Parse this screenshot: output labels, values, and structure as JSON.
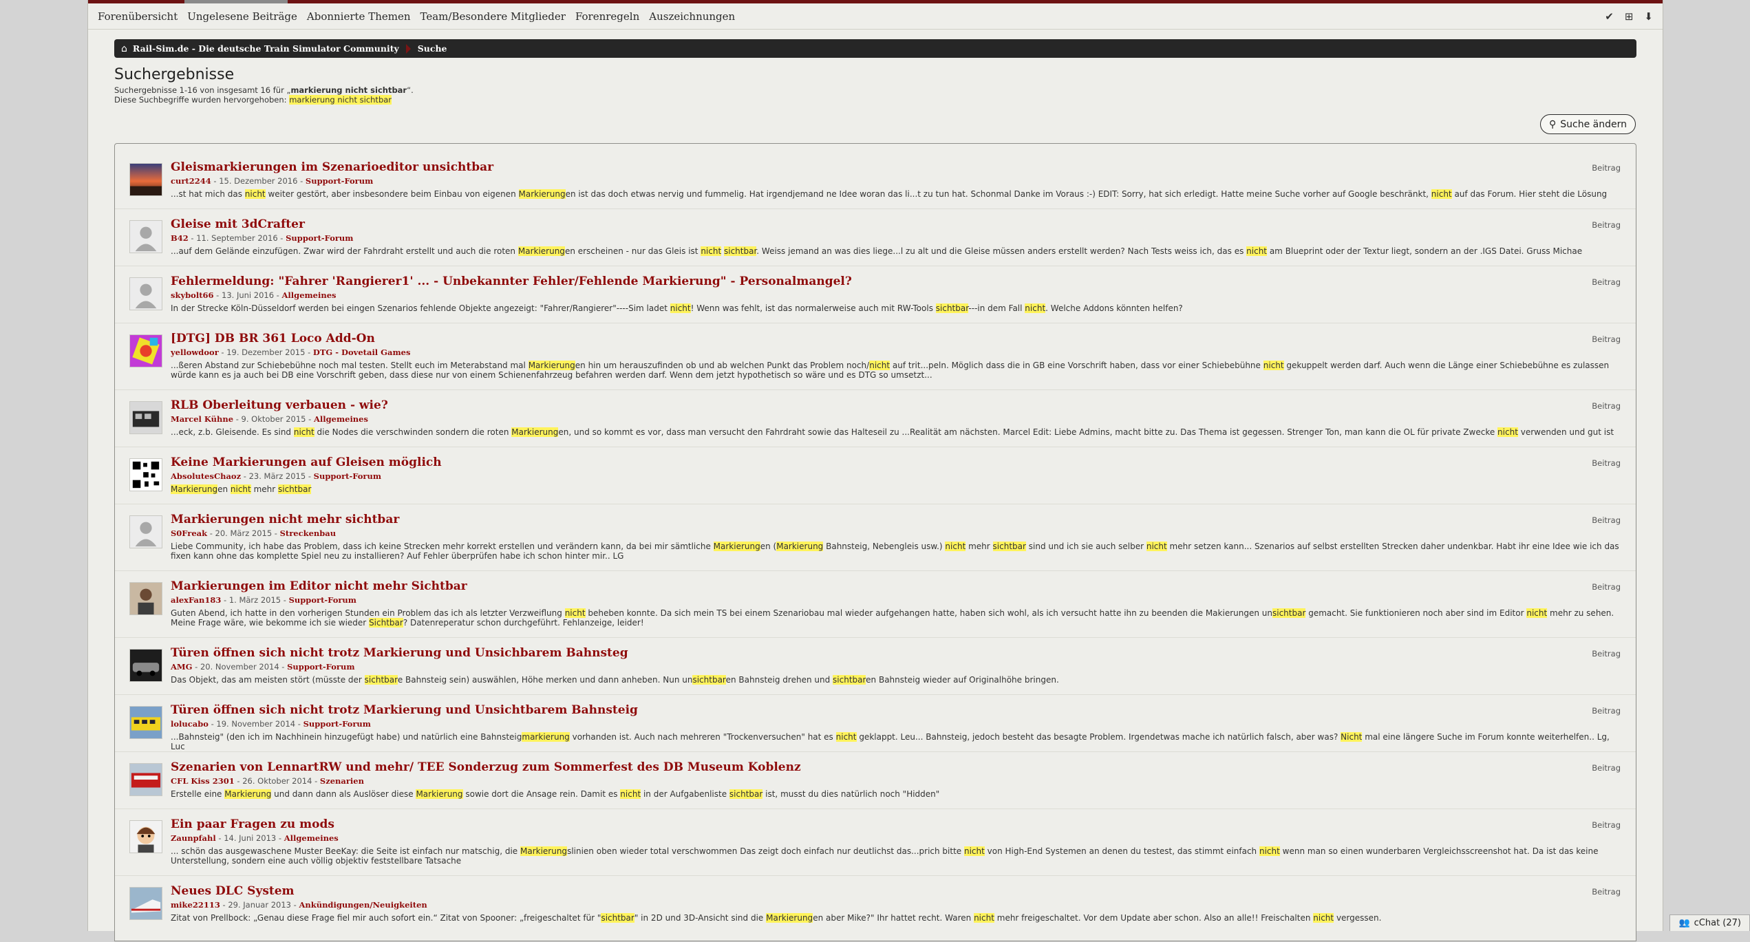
{
  "nav": {
    "items": [
      "Forenübersicht",
      "Ungelesene Beiträge",
      "Abonnierte Themen",
      "Team/Besondere Mitglieder",
      "Forenregeln",
      "Auszeichnungen"
    ],
    "icons": [
      "check-icon",
      "sitemap-icon",
      "arrow-down-icon"
    ]
  },
  "breadcrumb": {
    "site": "Rail-Sim.de - Die deutsche Train Simulator Community",
    "page": "Suche"
  },
  "title": "Suchergebnisse",
  "summary": {
    "line1_prefix": "Suchergebnisse 1-16 von insgesamt 16 für „",
    "query": "markierung nicht sichtbar",
    "line1_suffix": "“.",
    "line2_prefix": "Diese Suchbegriffe wurden hervorgehoben: ",
    "terms": "markierung nicht sichtbar"
  },
  "edit_button": "Suche ändern",
  "chat": "cChat (27)",
  "results": [
    {
      "title": "Gleismarkierungen im Szenarioeditor unsichtbar",
      "author": "curt2244",
      "date": "15. Dezember 2016",
      "forum": "Support-Forum",
      "type": "Beitrag",
      "avatar": "sunset",
      "snippet": "...st hat mich das [nicht] weiter gestört, aber insbesondere beim Einbau von eigenen [Markierung]en ist das doch etwas nervig und fummelig. Hat irgendjemand ne Idee woran das li...t zu tun hat. Schonmal Danke im Voraus :-) EDIT: Sorry, hat sich erledigt. Hatte meine Suche vorher auf Google beschränkt, [nicht] auf das Forum. Hier steht die Lösung"
    },
    {
      "title": "Gleise mit 3dCrafter",
      "author": "B42",
      "date": "11. September 2016",
      "forum": "Support-Forum",
      "type": "Beitrag",
      "avatar": "default",
      "snippet": "...auf dem Gelände einzufügen. Zwar wird der Fahrdraht erstellt und auch die roten [Markierung]en erscheinen - nur das Gleis ist [nicht] [sichtbar]. Weiss jemand an was dies liege...l zu alt und die Gleise müssen anders erstellt werden? Nach Tests weiss ich, das es [nicht] am Blueprint oder der Textur liegt, sondern an der .IGS Datei. Gruss Michae"
    },
    {
      "title": "Fehlermeldung: \"Fahrer 'Rangierer1' ... - Unbekannter Fehler/Fehlende Markierung\" - Personalmangel?",
      "author": "skybolt66",
      "date": "13. Juni 2016",
      "forum": "Allgemeines",
      "type": "Beitrag",
      "avatar": "default",
      "snippet": "In der Strecke Köln-Düsseldorf werden bei eingen Szenarios fehlende Objekte angezeigt: \"Fahrer/Rangierer\"----Sim ladet [nicht]! Wenn was fehlt, ist das normalerweise auch mit RW-Tools [sichtbar]---in dem Fall [nicht]. Welche Addons könnten helfen?"
    },
    {
      "title": "[DTG] DB BR 361 Loco Add-On",
      "author": "yellowdoor",
      "date": "19. Dezember 2015",
      "forum": "DTG - Dovetail Games",
      "type": "Beitrag",
      "avatar": "colorful",
      "snippet": "...ßeren Abstand zur Schiebebühne noch mal testen. Stellt euch im Meterabstand mal [Markierung]en hin um herauszufinden ob und ab welchen Punkt das Problem noch/[nicht] auf trit...peln. Möglich dass die in GB eine Vorschrift haben, dass vor einer Schiebebühne [nicht] gekuppelt werden darf. Auch wenn die Länge einer Schiebebühne es zulassen würde kann es ja auch bei DB eine Vorschrift geben, dass diese nur von einem Schienenfahrzeug befahren werden darf. Wenn dem jetzt hypothetisch so wäre und es DTG so umsetzt..."
    },
    {
      "title": "RLB Oberleitung verbauen - wie?",
      "author": "Marcel Kühne",
      "date": "9. Oktober 2015",
      "forum": "Allgemeines",
      "type": "Beitrag",
      "avatar": "train-bw",
      "snippet": "...eck, z.b. Gleisende. Es sind [nicht] die Nodes die verschwinden sondern die roten [Markierung]en, und so kommt es vor, dass man versucht den Fahrdraht sowie das Halteseil zu ...Realität am nächsten. Marcel Edit: Liebe Admins, macht bitte zu. Das Thema ist gegessen. Strenger Ton, man kann die OL für private Zwecke [nicht] verwenden und gut ist"
    },
    {
      "title": "Keine Markierungen auf Gleisen möglich",
      "author": "AbsolutesChaoz",
      "date": "23. März 2015",
      "forum": "Support-Forum",
      "type": "Beitrag",
      "avatar": "qr",
      "snippet": "[Markierung]en [nicht] mehr [sichtbar]"
    },
    {
      "title": "Markierungen nicht mehr sichtbar",
      "author": "S0Freak",
      "date": "20. März 2015",
      "forum": "Streckenbau",
      "type": "Beitrag",
      "avatar": "default",
      "snippet": "Liebe Community, ich habe das Problem, dass ich keine Strecken mehr korrekt erstellen und verändern kann, da bei mir sämtliche [Markierung]en ([Markierung] Bahnsteig, Nebengleis usw.) [nicht] mehr [sichtbar] sind und ich sie auch selber [nicht] mehr setzen kann... Szenarios auf selbst erstellten Strecken daher undenkbar. Habt ihr eine Idee wie ich das fixen kann ohne das komplette Spiel neu zu installieren? Auf Fehler überprüfen habe ich schon hinter mir.. LG"
    },
    {
      "title": "Markierungen im Editor nicht mehr Sichtbar",
      "author": "alexFan183",
      "date": "1. März 2015",
      "forum": "Support-Forum",
      "type": "Beitrag",
      "avatar": "person",
      "snippet": "Guten Abend, ich hatte in den vorherigen Stunden ein Problem das ich als letzter Verzweiflung [nicht] beheben konnte. Da sich mein TS bei einem Szenariobau mal wieder aufgehangen hatte, haben sich wohl, als ich versucht hatte ihn zu beenden die Makierungen un[sichtbar] gemacht. Sie funktionieren noch aber sind im Editor [nicht] mehr zu sehen. Meine Frage wäre, wie bekomme ich sie wieder [Sichtbar]? Datenreperatur schon durchgeführt. Fehlanzeige, leider!"
    },
    {
      "title": "Türen öffnen sich nicht trotz Markierung und Unsichbarem Bahnsteg",
      "author": "AMG",
      "date": "20. November 2014",
      "forum": "Support-Forum",
      "type": "Beitrag",
      "avatar": "car",
      "snippet": "Das Objekt, das am meisten stört (müsste der [sichtbar]e Bahnsteig sein) auswählen, Höhe merken und dann anheben. Nun un[sichtbar]en Bahnsteig drehen und [sichtbar]en Bahnsteig wieder auf Originalhöhe bringen."
    },
    {
      "title": "Türen öffnen sich nicht trotz Markierung und Unsichtbarem Bahnsteig",
      "author": "lolucabo",
      "date": "19. November 2014",
      "forum": "Support-Forum",
      "type": "Beitrag",
      "avatar": "train-yellow",
      "snippet": "...Bahnsteig\" (den ich im Nachhinein hinzugefügt habe) und natürlich eine Bahnsteig[markierung] vorhanden ist. Auch nach mehreren \"Trockenversuchen\" hat es [nicht] geklappt. Leu... Bahnsteig, jedoch besteht das besagte Problem. Irgendetwas mache ich natürlich falsch, aber was? [Nicht] mal eine längere Suche im Forum konnte weiterhelfen.. Lg, Luc"
    },
    {
      "title": "Szenarien von LennartRW und mehr/ TEE Sonderzug zum Sommerfest des DB Museum Koblenz",
      "author": "CFL Kiss 2301",
      "date": "26. Oktober 2014",
      "forum": "Szenarien",
      "type": "Beitrag",
      "avatar": "train-red",
      "snippet": "Erstelle eine [Markierung] und dann dann als Auslöser diese [Markierung] sowie dort die Ansage rein. Damit es [nicht] in der Aufgabenliste [sichtbar] ist, musst du dies natürlich noch \"Hidden\""
    },
    {
      "title": "Ein paar Fragen zu mods",
      "author": "Zaunpfahl",
      "date": "14. Juni 2013",
      "forum": "Allgemeines",
      "type": "Beitrag",
      "avatar": "cartoon",
      "snippet": "... schön das ausgewaschene Muster BeeKay: die Seite ist einfach nur matschig, die [Markierung]slinien oben wieder total verschwommen Das zeigt doch einfach nur deutlichst das...prich bitte [nicht] von High-End Systemen an denen du testest, das stimmt einfach [nicht] wenn man so einen wunderbaren Vergleichsscreenshot hat. Da ist das keine Unterstellung, sondern eine auch völlig objektiv feststellbare Tatsache"
    },
    {
      "title": "Neues DLC System",
      "author": "mike22113",
      "date": "29. Januar 2013",
      "forum": "Ankündigungen/Neuigkeiten",
      "type": "Beitrag",
      "avatar": "train-ice",
      "snippet": "Zitat von Prellbock: „Genau diese Frage fiel mir auch sofort ein.“ Zitat von Spooner: „freigeschaltet für \"[sichtbar]\" in 2D und 3D-Ansicht sind die [Markierung]en aber Mike?\" Ihr hattet recht. Waren [nicht] mehr freigeschaltet. Vor dem Update aber schon. Also an alle!! Freischalten [nicht] vergessen."
    }
  ]
}
